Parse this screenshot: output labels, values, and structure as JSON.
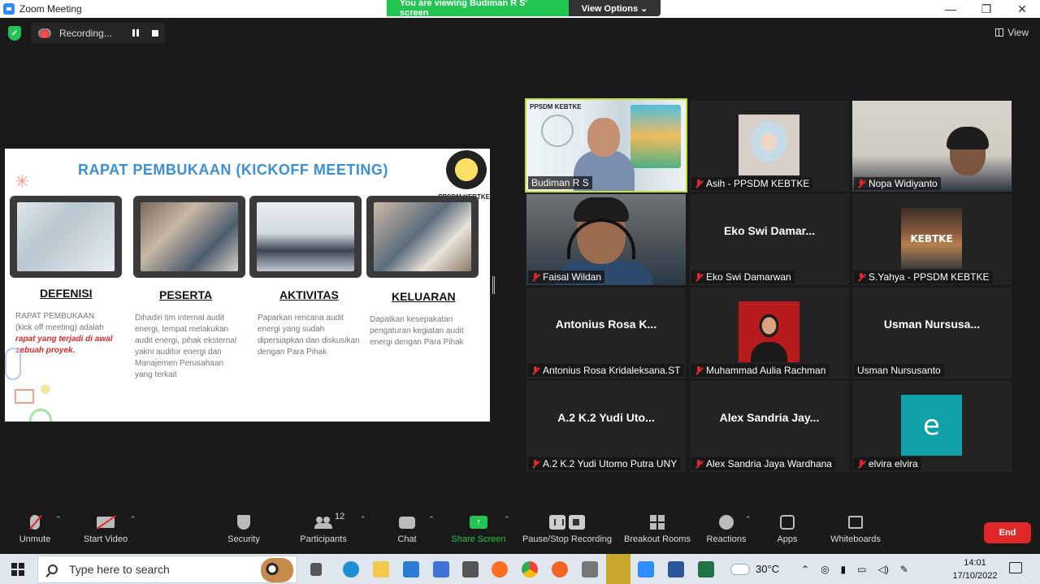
{
  "window": {
    "title": "Zoom Meeting",
    "banner": "You are viewing Budiman R S' screen",
    "view_options": "View Options ⌄",
    "minimize": "—",
    "restore": "❐",
    "close": "✕"
  },
  "top_bar": {
    "recording_label": "Recording...",
    "view_label": "View"
  },
  "slide": {
    "title": "RAPAT PEMBUKAAN (KICKOFF MEETING)",
    "logo_text": "PPSDM KEBTKE",
    "columns": [
      {
        "heading": "DEFENISI",
        "body_pre": "RAPAT PEMBUKAAN (kick off meeting) adalah ",
        "body_hl": "rapat yang terjadi di awal sebuah proyek."
      },
      {
        "heading": "PESERTA",
        "body_pre": "Dihadiri tim internal audit energi, tempat melakukan audit energi, pihak eksternal yakni auditor energi dan Manajemen Perusahaan yang terkait",
        "body_hl": ""
      },
      {
        "heading": "AKTIVITAS",
        "body_pre": "Paparkan rencana audit energi yang sudah dipersiapkan dan diskusikan dengan Para Pihak",
        "body_hl": ""
      },
      {
        "heading": "KELUARAN",
        "body_pre": "Dapatkan kesepakatan pengaturan kegiatan audit energi dengan Para Pihak",
        "body_hl": ""
      }
    ]
  },
  "participants": [
    {
      "name": "Budiman R S",
      "muted": false,
      "display": "video",
      "active": true,
      "brand": "PPSDM KEBTKE"
    },
    {
      "name": "Asih - PPSDM KEBTKE",
      "muted": true,
      "display": "avatar"
    },
    {
      "name": "Nopa Widiyanto",
      "muted": true,
      "display": "video"
    },
    {
      "name": "Faisal Wildan",
      "muted": true,
      "display": "video"
    },
    {
      "name": "Eko Swi Damarwan",
      "muted": true,
      "display": "name",
      "center": "Eko Swi Damar..."
    },
    {
      "name": "S.Yahya - PPSDM KEBTKE",
      "muted": true,
      "display": "avatar",
      "avatar_text": "KEBTKE"
    },
    {
      "name": "Antonius Rosa Kridaleksana.ST",
      "muted": true,
      "display": "name",
      "center": "Antonius Rosa K..."
    },
    {
      "name": "Muhammad Aulia Rachman",
      "muted": true,
      "display": "avatar"
    },
    {
      "name": "Usman Nursusanto",
      "muted": false,
      "display": "name",
      "center": "Usman Nursusa..."
    },
    {
      "name": "A.2 K.2 Yudi Utomo Putra UNY",
      "muted": true,
      "display": "name",
      "center": "A.2 K.2 Yudi Uto..."
    },
    {
      "name": "Alex Sandria Jaya Wardhana",
      "muted": true,
      "display": "name",
      "center": "Alex Sandria Jay..."
    },
    {
      "name": "elvira elvira",
      "muted": true,
      "display": "avatar",
      "avatar_text": "e"
    }
  ],
  "toolbar": {
    "unmute": "Unmute",
    "start_video": "Start Video",
    "security": "Security",
    "participants": "Participants",
    "participant_count": "12",
    "chat": "Chat",
    "share_screen": "Share Screen",
    "pause_stop_recording": "Pause/Stop Recording",
    "breakout_rooms": "Breakout Rooms",
    "reactions": "Reactions",
    "apps": "Apps",
    "whiteboards": "Whiteboards",
    "end": "End"
  },
  "taskbar": {
    "search_placeholder": "Type here to search",
    "temperature": "30°C",
    "time": "14:01",
    "date": "17/10/2022"
  },
  "colors": {
    "zoom_green": "#23c552",
    "active_border": "#c4e03a",
    "end_red": "#e02828",
    "slide_title_blue": "#3a8fd6"
  }
}
